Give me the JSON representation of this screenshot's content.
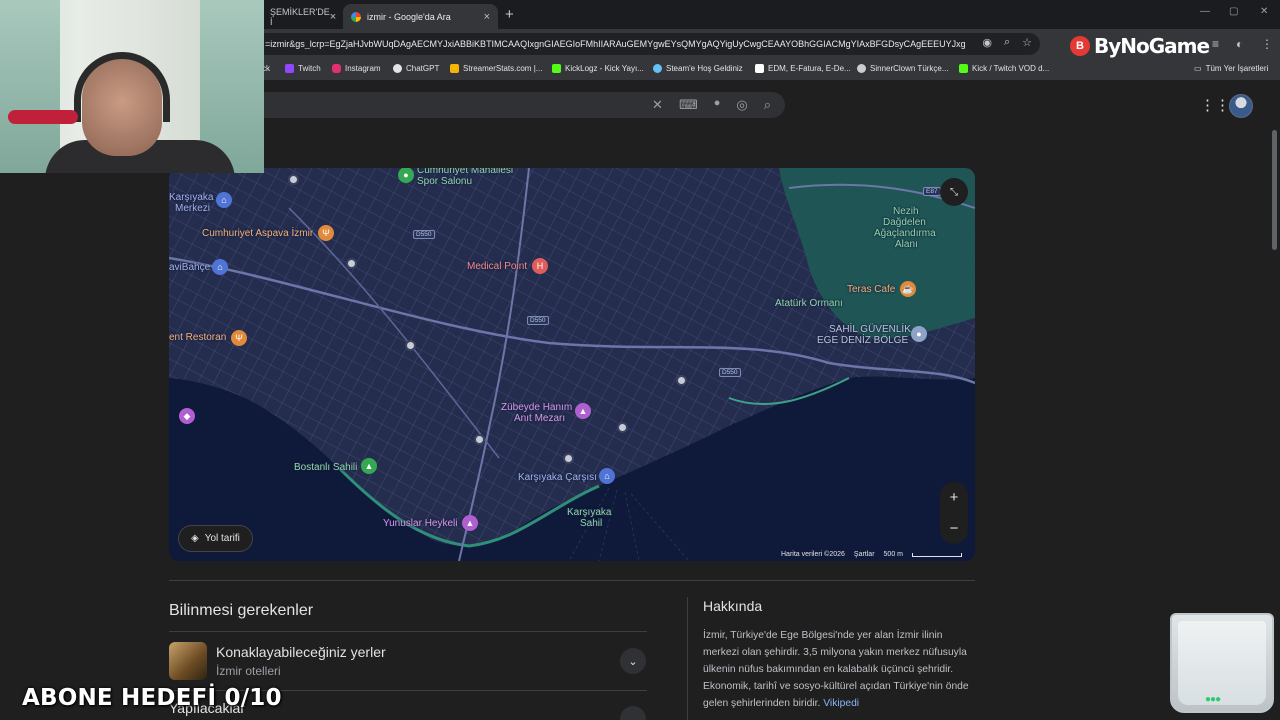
{
  "browser": {
    "tabs": [
      {
        "title": "ŞEMİKLER'DE İ",
        "close": "×"
      },
      {
        "title": "izmir - Google'da Ara",
        "close": "×"
      }
    ],
    "new_tab": "+",
    "window_controls": [
      "—",
      "▢",
      "✕"
    ],
    "url": "=izmir&gs_lcrp=EgZjaHJvbWUqDAgAECMYJxiABBiKBTIMCAAQIxgnGIAEGIoFMhIIARAuGEMYgwEYsQMYgAQYigUyCwgCEAAYOBhGGIACMgYIAxBFGDsyCAgEEEUYJxg7MgY...",
    "bookmarks": [
      {
        "label": "ck",
        "color": "#888888"
      },
      {
        "label": "Twitch",
        "color": "#9146ff"
      },
      {
        "label": "Instagram",
        "color": "#e1306c"
      },
      {
        "label": "ChatGPT",
        "color": "#e3e3e3"
      },
      {
        "label": "StreamerStats.com |...",
        "color": "#f4b400"
      },
      {
        "label": "KickLogz - Kick Yayı...",
        "color": "#53fc18"
      },
      {
        "label": "Steam'e Hoş Geldiniz",
        "color": "#66c0f4"
      },
      {
        "label": "EDM, E-Fatura, E-De...",
        "color": "#ffffff"
      },
      {
        "label": "SinnerClown Türkçe...",
        "color": "#cccccc"
      },
      {
        "label": "Kick / Twitch VOD d...",
        "color": "#53fc18"
      }
    ],
    "all_bookmarks": "Tüm Yer İşaretleri"
  },
  "overlay": {
    "brand": "ByNoGame",
    "brand_logo": "B",
    "banner": "ABONE HEDEFİ 0/10"
  },
  "search": {
    "clear_icon": "✕",
    "keyboard_icon": "⌨",
    "mic_icon": "🎤",
    "lens_icon": "◎",
    "search_icon": "⌕"
  },
  "map": {
    "labels": [
      {
        "text": "Cumhuriyet Mahallesi",
        "color": "#8fd6a8"
      },
      {
        "text": "Spor Salonu",
        "color": "#8fd6a8"
      },
      {
        "text": "Karşıyaka",
        "color": "#9fb3e8"
      },
      {
        "text": "Merkezi",
        "color": "#9fb3e8"
      },
      {
        "text": "Cumhuriyet Aspava İzmir",
        "color": "#f0b27a"
      },
      {
        "text": "aviBahçe",
        "color": "#9fb3e8"
      },
      {
        "text": "Medical Point",
        "color": "#f08a8a"
      },
      {
        "text": "ent Restoran",
        "color": "#f0b27a"
      },
      {
        "text": "Nezih",
        "color": "#8fd6a8"
      },
      {
        "text": "Dağdelen",
        "color": "#8fd6a8"
      },
      {
        "text": "Ağaçlandırma",
        "color": "#8fd6a8"
      },
      {
        "text": "Alanı",
        "color": "#8fd6a8"
      },
      {
        "text": "Teras Cafe",
        "color": "#f0b27a"
      },
      {
        "text": "Atatürk Ormanı",
        "color": "#8fd6a8"
      },
      {
        "text": "SAHİL GÜVENLİK",
        "color": "#b8c4d8"
      },
      {
        "text": "EGE DENİZ BÖLGE",
        "color": "#b8c4d8"
      },
      {
        "text": "Zübeyde Hanım",
        "color": "#d69ae8"
      },
      {
        "text": "Anıt Mezarı",
        "color": "#d69ae8"
      },
      {
        "text": "Bostanlı Sahili",
        "color": "#8fd6a8"
      },
      {
        "text": "Karşıyaka Çarşısı",
        "color": "#9fb3e8"
      },
      {
        "text": "Karşıyaka",
        "color": "#8fd6a8"
      },
      {
        "text": "Sahil",
        "color": "#8fd6a8"
      },
      {
        "text": "Yunuslar Heykeli",
        "color": "#d69ae8"
      }
    ],
    "road_signs": [
      "D550",
      "D550",
      "D550",
      "E87"
    ],
    "directions_button": "Yol tarifi",
    "zoom_in": "+",
    "zoom_out": "−",
    "attribution": "Harita verileri ©2026",
    "terms": "Şartlar",
    "scale": "500 m"
  },
  "know": {
    "heading": "Bilinmesi gerekenler",
    "rows": [
      {
        "title": "Konaklayabileceğiniz yerler",
        "subtitle": "İzmir otelleri"
      },
      {
        "title": "Yapılacaklar",
        "subtitle": ""
      }
    ]
  },
  "about": {
    "heading": "Hakkında",
    "text": "İzmir, Türkiye'de Ege Bölgesi'nde yer alan İzmir ilinin merkezi olan şehirdir. 3,5 milyona yakın merkez nüfusuyla ülkenin nüfus bakımından en kalabalık üçüncü şehridir. Ekonomik, tarihî ve sosyo-kültürel açıdan Türkiye'nin önde gelen şehirlerinden biridir.",
    "link": "Vikipedi"
  }
}
